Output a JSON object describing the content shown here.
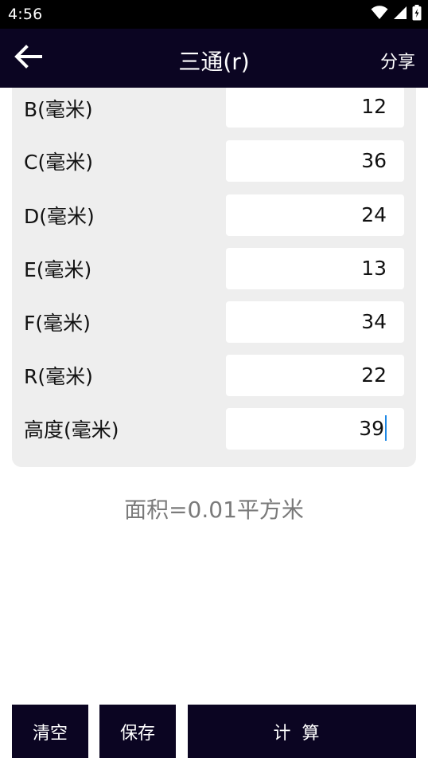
{
  "status_bar": {
    "time": "4:56",
    "icons": [
      "wifi-icon",
      "signal-icon",
      "battery-charging-icon"
    ]
  },
  "app_bar": {
    "back_icon": "arrow-left-icon",
    "title": "三通(r)",
    "share_label": "分享"
  },
  "form": {
    "fields": [
      {
        "label": "B(毫米)",
        "value": "12"
      },
      {
        "label": "C(毫米)",
        "value": "36"
      },
      {
        "label": "D(毫米)",
        "value": "24"
      },
      {
        "label": "E(毫米)",
        "value": "13"
      },
      {
        "label": "F(毫米)",
        "value": "34"
      },
      {
        "label": "R(毫米)",
        "value": "22"
      },
      {
        "label": "高度(毫米)",
        "value": "39"
      }
    ]
  },
  "result": {
    "text": "面积=0.01平方米"
  },
  "buttons": {
    "clear_label": "清空",
    "save_label": "保存",
    "calculate_label": "计算"
  },
  "colors": {
    "app_bar_bg": "#0b0522",
    "status_bar_bg": "#000000",
    "card_bg": "#eeeeee",
    "result_text": "#7a7a7a",
    "caret": "#1e88e5"
  }
}
